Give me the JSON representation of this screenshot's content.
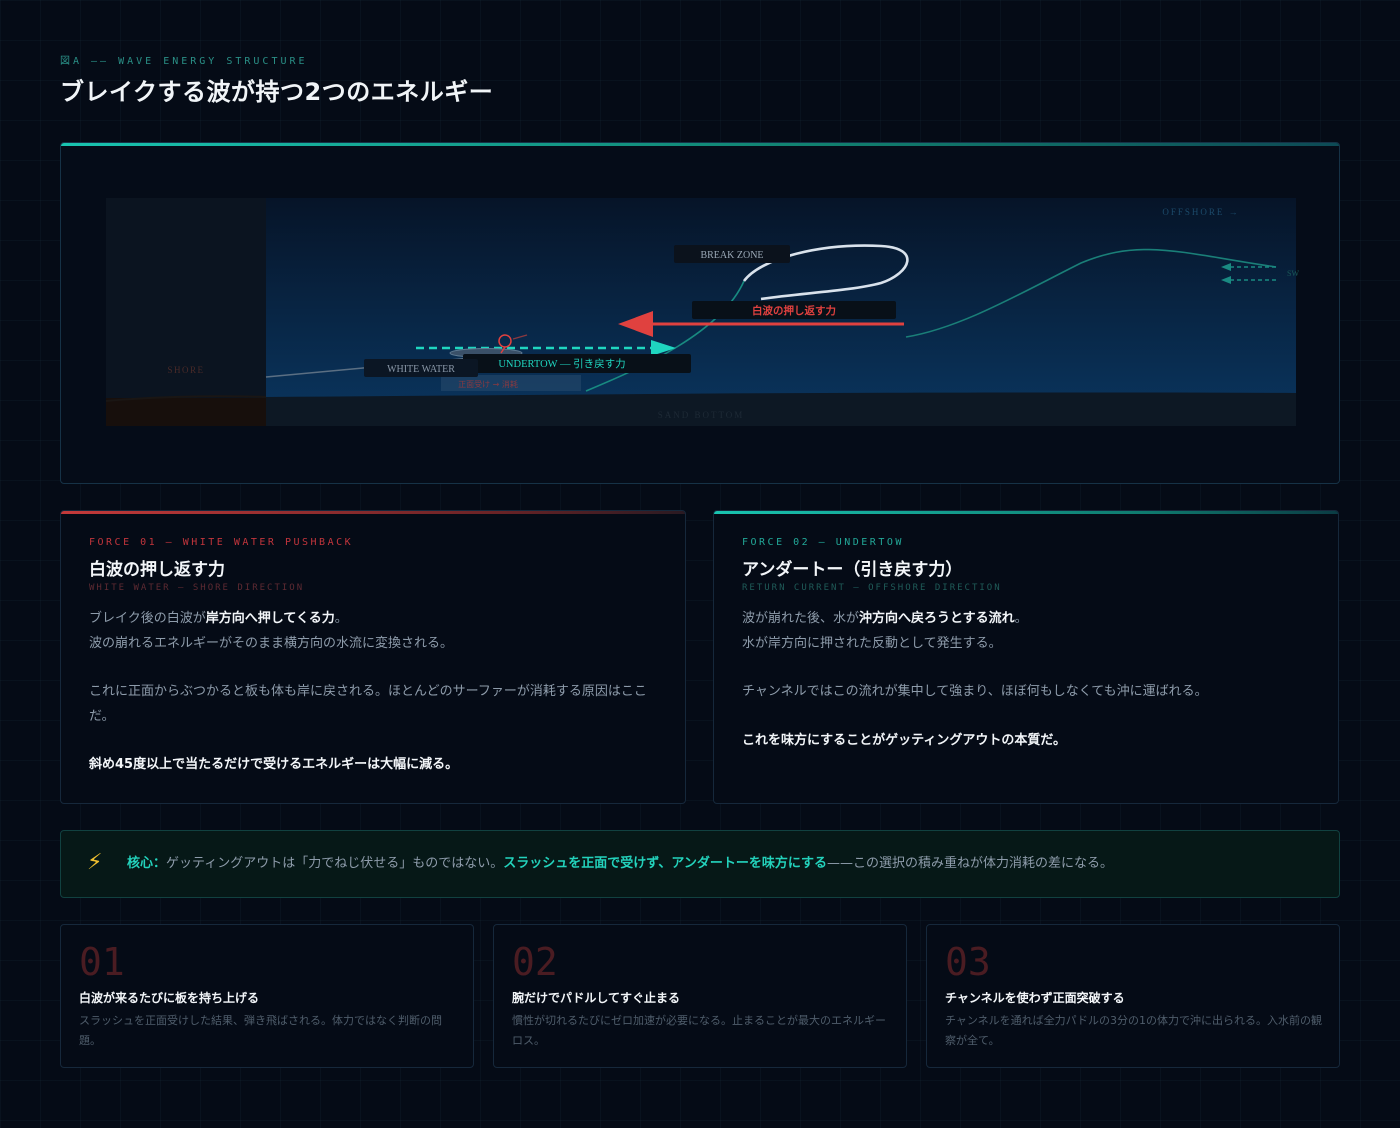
{
  "header": {
    "eyebrow": "図A —— WAVE ENERGY STRUCTURE",
    "title": "ブレイクする波が持つ2つのエネルギー"
  },
  "diagram": {
    "labels": {
      "offshore": "OFFSHORE →",
      "shore": "SHORE",
      "break_zone": "BREAK ZONE",
      "white_water": "WHITE WATER",
      "pushback": "白波の押し返す力",
      "undertow": "UNDERTOW — 引き戻す力",
      "head_on": "正面受け → 消耗",
      "sand_bottom": "SAND BOTTOM",
      "edge_fragment": "SW"
    },
    "colors": {
      "pushback": "#e0413f",
      "undertow": "#1fd6c0",
      "wave_lip": "#d9e2ec",
      "swell": "#1a7f78"
    }
  },
  "cards": {
    "force1": {
      "tag": "FORCE 01 — WHITE WATER PUSHBACK",
      "title": "白波の押し返す力",
      "subtitle": "WHITE WATER — SHORE DIRECTION",
      "p1_pre": "ブレイク後の白波が",
      "p1_bold": "岸方向へ押してくる力",
      "p1_post": "。",
      "p1_line2": "波の崩れるエネルギーがそのまま横方向の水流に変換される。",
      "p2": "これに正面からぶつかると板も体も岸に戻される。ほとんどのサーファーが消耗する原因はここだ。",
      "p3": "斜め45度以上で当たるだけで受けるエネルギーは大幅に減る。"
    },
    "force2": {
      "tag": "FORCE 02 — UNDERTOW",
      "title": "アンダートー（引き戻す力）",
      "subtitle": "RETURN CURRENT — OFFSHORE DIRECTION",
      "p1_pre": "波が崩れた後、水が",
      "p1_bold": "沖方向へ戻ろうとする流れ",
      "p1_post": "。",
      "p1_line2": "水が岸方向に押された反動として発生する。",
      "p2": "チャンネルではこの流れが集中して強まり、ほぼ何もしなくても沖に運ばれる。",
      "p3": "これを味方にすることがゲッティングアウトの本質だ。"
    }
  },
  "core": {
    "label": "核心：",
    "text1": "ゲッティングアウトは「力でねじ伏せる」ものではない。",
    "highlight": "スラッシュを正面で受けず、アンダートーを味方にする",
    "text2": "——この選択の積み重ねが体力消耗の差になる。"
  },
  "mistakes": [
    {
      "num": "01",
      "title": "白波が来るたびに板を持ち上げる",
      "desc": "スラッシュを正面受けした結果、弾き飛ばされる。体力ではなく判断の問題。"
    },
    {
      "num": "02",
      "title": "腕だけでパドルしてすぐ止まる",
      "desc": "慣性が切れるたびにゼロ加速が必要になる。止まることが最大のエネルギーロス。"
    },
    {
      "num": "03",
      "title": "チャンネルを使わず正面突破する",
      "desc": "チャンネルを通れば全力パドルの3分の1の体力で沖に出られる。入水前の観察が全て。"
    }
  ]
}
